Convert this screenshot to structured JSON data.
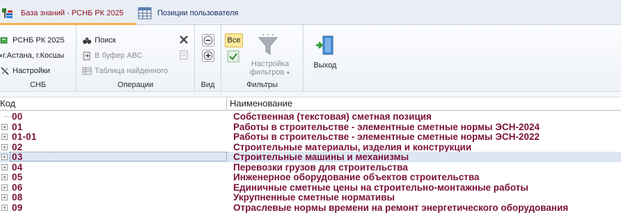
{
  "tabs": [
    {
      "label": "База знаний - РСНБ РК 2025",
      "icon": "knowledge-base-icon",
      "active": true
    },
    {
      "label": "Позиции пользователя",
      "icon": "table-grid-icon",
      "active": false
    }
  ],
  "ribbon": {
    "groups": {
      "snb": {
        "caption": "СНБ",
        "items": [
          {
            "label": "РСНБ РК 2025",
            "icon": "database-icon"
          },
          {
            "label": "г.Астана, г.Косшы",
            "icon": "location-icon"
          },
          {
            "label": "Настройки",
            "icon": "wrench-icon"
          }
        ]
      },
      "operations": {
        "caption": "Операции",
        "items": [
          {
            "label": "Поиск",
            "icon": "binoculars-icon",
            "enabled": true
          },
          {
            "label": "В буфер АВС",
            "icon": "clipboard-icon",
            "enabled": false
          },
          {
            "label": "Таблица найденного",
            "icon": "table-icon",
            "enabled": false
          }
        ]
      },
      "view": {
        "caption": "Вид"
      },
      "filters": {
        "caption": "Фильтры",
        "all_label": "Все",
        "settings_label_1": "Настройка",
        "settings_label_2": "фильтров"
      },
      "exit": {
        "label": "Выход",
        "icon": "exit-door-icon"
      }
    }
  },
  "grid": {
    "columns": [
      "Код",
      "Наименование"
    ],
    "rows": [
      {
        "code": "00",
        "name": "Собственная (текстовая) сметная позиция",
        "expandable": false
      },
      {
        "code": "01",
        "name": "Работы в строительстве - элементные сметные нормы ЭСН-2024",
        "expandable": true
      },
      {
        "code": "01-01",
        "name": "Работы в строительстве - элементные сметные нормы ЭСН-2022",
        "expandable": true
      },
      {
        "code": "02",
        "name": "Строительные материалы, изделия и конструкции",
        "expandable": true
      },
      {
        "code": "03",
        "name": "Строительные машины и механизмы",
        "expandable": true,
        "selected": true
      },
      {
        "code": "04",
        "name": "Перевозки грузов для строительства",
        "expandable": true
      },
      {
        "code": "05",
        "name": "Инженерное оборудование объектов строительства",
        "expandable": true
      },
      {
        "code": "06",
        "name": "Единичные сметные цены на строительно-монтажные работы",
        "expandable": true
      },
      {
        "code": "08",
        "name": "Укрупненные сметные нормативы",
        "expandable": true
      },
      {
        "code": "09",
        "name": "Отраслевые нормы времени на ремонт энергетического оборудования",
        "expandable": true
      }
    ]
  },
  "colors": {
    "row_text": "#7a0f3a",
    "selection": "#dde7f3",
    "active_tab_accent": "#f0b24a"
  }
}
